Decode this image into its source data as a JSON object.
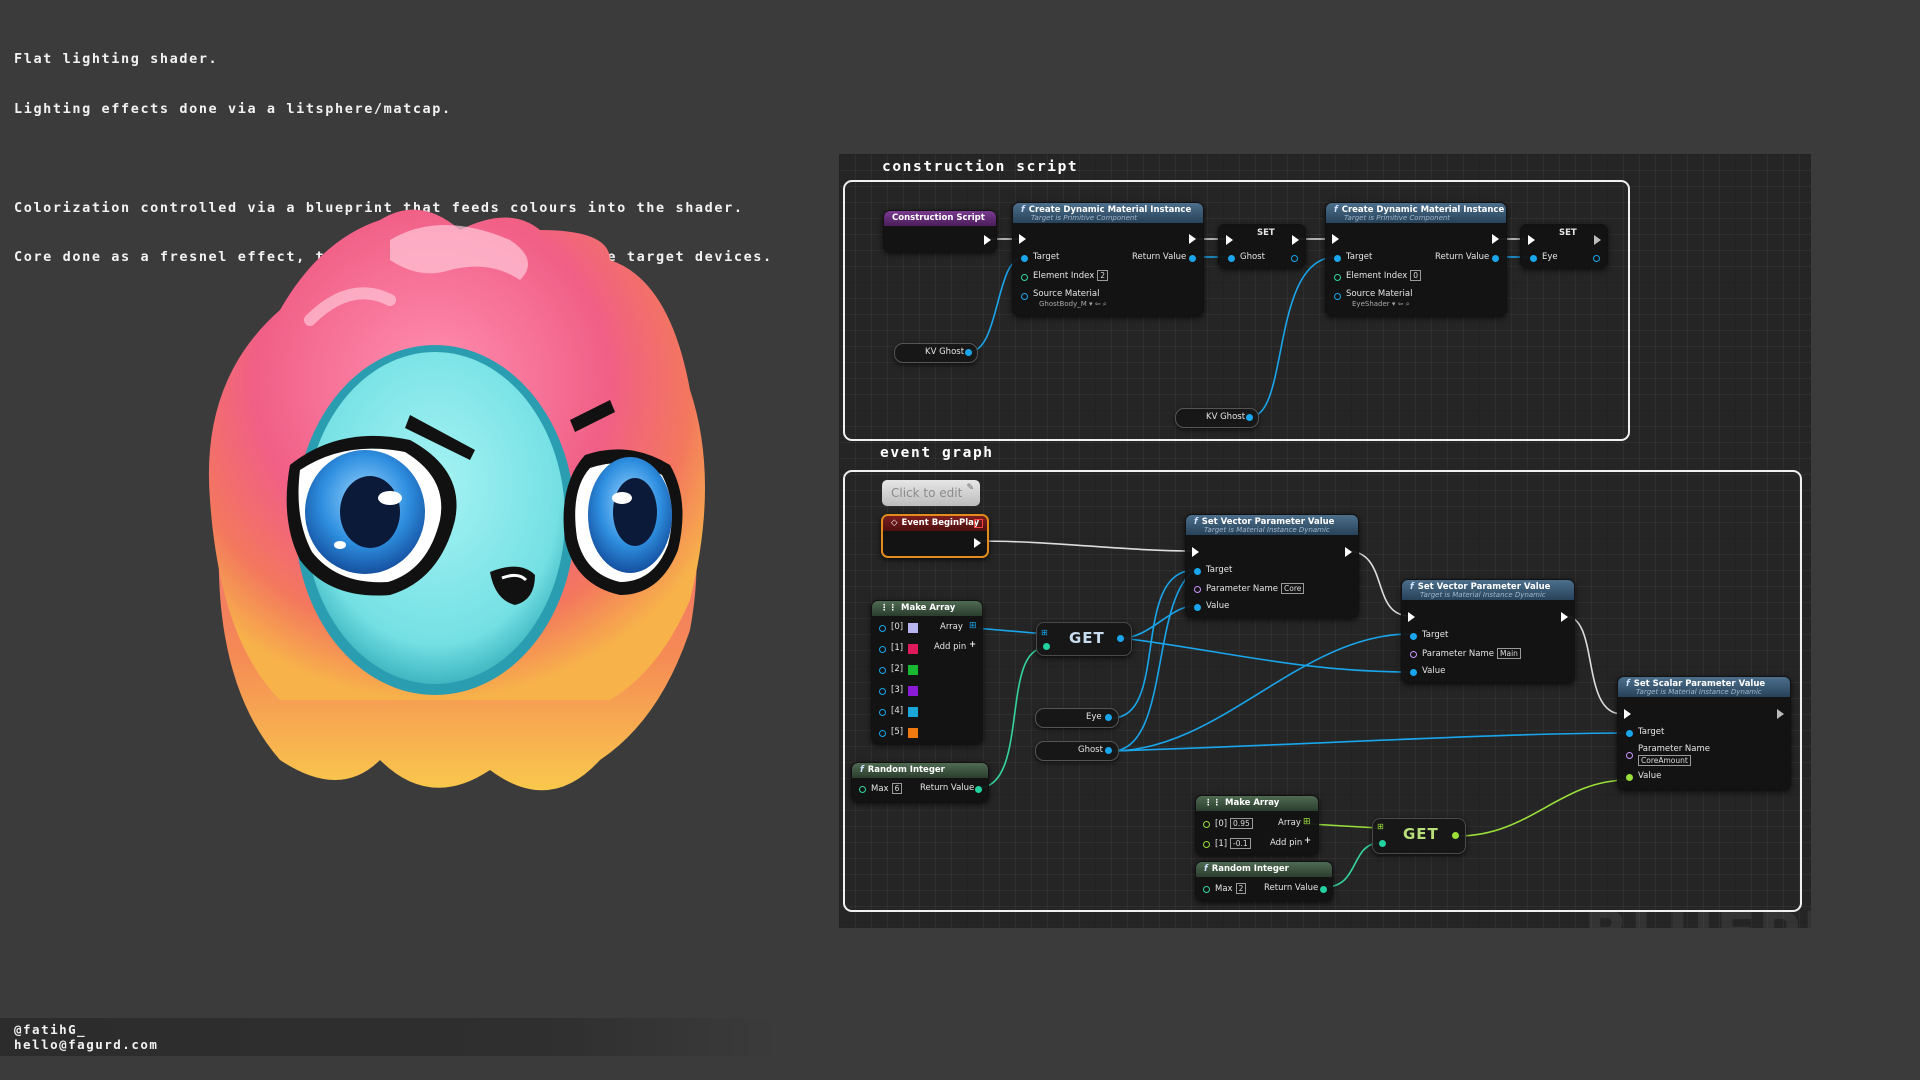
{
  "intro_lines": [
    "Flat lighting shader.",
    "Lighting effects done via a litsphere/matcap.",
    "",
    "Colorization controlled via a blueprint that feeds colours into the shader.",
    "Core done as a fresnel effect, to avoid transparency on mobile target devices."
  ],
  "credits": {
    "handle": "@fatihG_",
    "email": "hello@fagurd.com"
  },
  "blueprint": {
    "watermark": "BLUEPRI",
    "construction_title": "construction script",
    "event_title": "event graph",
    "comment": "Click to edit",
    "construction_script": "Construction Script",
    "cdmi1": {
      "title": "Create Dynamic Material Instance",
      "subtitle": "Target is Primitive Component",
      "target": "Target",
      "return_value": "Return Value",
      "element_index": "Element Index",
      "element_index_val": "2",
      "source_material": "Source Material",
      "source_val": "GhostBody_M"
    },
    "set1": {
      "title": "SET",
      "var": "Ghost"
    },
    "cdmi2": {
      "title": "Create Dynamic Material Instance",
      "subtitle": "Target is Primitive Component",
      "target": "Target",
      "return_value": "Return Value",
      "element_index": "Element Index",
      "element_index_val": "0",
      "source_material": "Source Material",
      "source_val": "EyeShader"
    },
    "set2": {
      "title": "SET",
      "var": "Eye"
    },
    "kv_ghost_1": "KV Ghost",
    "kv_ghost_2": "KV Ghost",
    "event_beginplay": "Event BeginPlay",
    "svp1": {
      "title": "Set Vector Parameter Value",
      "subtitle": "Target is Material Instance Dynamic",
      "target": "Target",
      "param_name": "Parameter Name",
      "param_val": "Core",
      "value": "Value"
    },
    "svp2": {
      "title": "Set Vector Parameter Value",
      "subtitle": "Target is Material Instance Dynamic",
      "target": "Target",
      "param_name": "Parameter Name",
      "param_val": "Main",
      "value": "Value"
    },
    "ssp": {
      "title": "Set Scalar Parameter Value",
      "subtitle": "Target is Material Instance Dynamic",
      "target": "Target",
      "param_name": "Parameter Name",
      "param_val": "CoreAmount",
      "value": "Value"
    },
    "make_array_1": {
      "title": "Make Array",
      "array": "Array",
      "add_pin": "Add pin",
      "items": [
        "[0]",
        "[1]",
        "[2]",
        "[3]",
        "[4]",
        "[5]"
      ],
      "colors": [
        "#b7b4f0",
        "#e01a5a",
        "#19b833",
        "#8a1ad8",
        "#1aa6d8",
        "#f07a10"
      ]
    },
    "get_1": "GET",
    "eye_var": "Eye",
    "ghost_var": "Ghost",
    "random_int_1": {
      "title": "Random Integer",
      "max": "Max",
      "max_val": "6",
      "return_value": "Return Value"
    },
    "make_array_2": {
      "title": "Make Array",
      "array": "Array",
      "add_pin": "Add pin",
      "items": [
        "[0]",
        "[1]"
      ],
      "values": [
        "0.95",
        "-0.1"
      ]
    },
    "get_2": "GET",
    "random_int_2": {
      "title": "Random Integer",
      "max": "Max",
      "max_val": "2",
      "return_value": "Return Value"
    }
  },
  "colors": {
    "background": "#3b3b3b",
    "graph_bg": "#252525",
    "pink": "#f06a8c",
    "cyan": "#7fe3e6",
    "eye_blue": "#2a8fd8"
  }
}
